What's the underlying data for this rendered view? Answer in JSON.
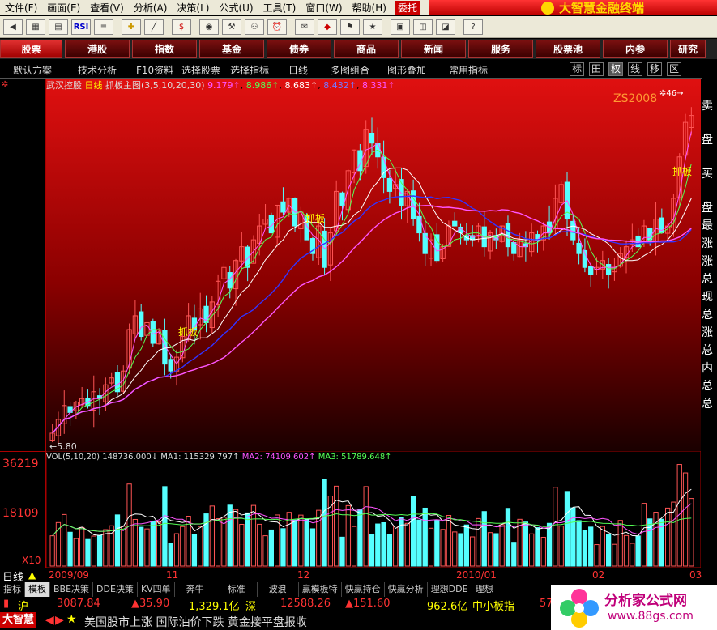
{
  "menu": {
    "items": [
      "文件(F)",
      "画面(E)",
      "查看(V)",
      "分析(A)",
      "决策(L)",
      "公式(U)",
      "工具(T)",
      "窗口(W)",
      "帮助(H)"
    ],
    "window_tag": "委托",
    "app_title": "大智慧金融终端"
  },
  "toolbar": {
    "rsi_label": "RSI"
  },
  "categories": [
    "股票",
    "港股",
    "指数",
    "基金",
    "债券",
    "商品",
    "新闻",
    "服务",
    "股票池",
    "内参",
    "研究"
  ],
  "funcbar": {
    "items": [
      "默认方案",
      "技术分析",
      "F10资料",
      "选择股票",
      "选择指标",
      "日线",
      "多图组合",
      "图形叠加",
      "常用指标"
    ],
    "buttons": [
      "标",
      "田",
      "权",
      "线",
      "移",
      "区"
    ]
  },
  "chart_header": {
    "stock": "武汉控股",
    "period": "日线",
    "indicator": "抓板主图(3,5,10,20,30)",
    "values": [
      "9.179↑",
      "8.986↑",
      "8.683↑",
      "8.432↑",
      "8.331↑"
    ],
    "colors": [
      "#ff55ff",
      "#55ff55",
      "#ffffff",
      "#5555ff",
      "#ff55ff"
    ],
    "watermark": "ZS2008",
    "high_label": "46",
    "low_label": "5.80",
    "signal": "抓板"
  },
  "vol_header": {
    "label": "VOL(5,10,20)",
    "vol": "148736.000↓",
    "ma1": "MA1: 115329.797↑",
    "ma2": "MA2: 74109.602↑",
    "ma3": "MA3: 51789.648↑"
  },
  "axis": {
    "vol_top": "36219",
    "vol_mid": "18109",
    "vol_unit": "X10",
    "dates": [
      "2009/09",
      "11",
      "12",
      "2010/01",
      "02",
      "03"
    ]
  },
  "right_panel": [
    "卖",
    "盘",
    "买",
    "盘",
    "最",
    "涨",
    "涨",
    "总",
    "现",
    "总",
    "涨",
    "总",
    "内",
    "总",
    "总"
  ],
  "day_label": "日线",
  "bottom_tabs": [
    "指标",
    "模板",
    "BBE决策",
    "DDE决策",
    "KV四单",
    "奔牛",
    "标准",
    "波浪",
    "赢模板特",
    "快赢持仓",
    "快赢分析",
    "理想DDE",
    "理想"
  ],
  "quotes": {
    "sh_label": "沪",
    "sh_price": "3087.84",
    "sh_change": "▲35.90",
    "sh_amount": "1,329.1亿",
    "sz_label": "深",
    "sz_price": "12588.26",
    "sz_change": "▲151.60",
    "sz_amount": "962.6亿",
    "sme_label": "中小板指",
    "sme_price": "57"
  },
  "news": {
    "logo": "大智慧",
    "text": "美国股市上涨 国际油价下跌 黄金接平盘报收"
  },
  "watermark_site": {
    "title": "分析家公式网",
    "url": "www.88gs.com"
  },
  "chart_data": {
    "type": "candlestick",
    "title": "武汉控股 日线",
    "low_label_value": 5.8,
    "closes": [
      5.9,
      6.1,
      6.3,
      6.2,
      6.35,
      6.4,
      6.3,
      6.5,
      6.4,
      6.6,
      6.7,
      6.5,
      6.8,
      7.4,
      7.6,
      7.3,
      7.5,
      7.2,
      7.4,
      6.9,
      6.8,
      7.0,
      7.3,
      7.6,
      7.4,
      7.7,
      7.5,
      7.8,
      8.1,
      8.3,
      8.0,
      8.4,
      8.6,
      8.3,
      8.7,
      8.9,
      9.0,
      8.8,
      9.2,
      9.1,
      9.3,
      8.9,
      9.1,
      8.7,
      8.5,
      8.9,
      8.3,
      8.8,
      9.4,
      9.2,
      9.7,
      10.0,
      9.7,
      10.3,
      10.1,
      9.9,
      9.6,
      9.4,
      9.5,
      9.2,
      9.4,
      9.0,
      8.8,
      8.5,
      8.7,
      8.4,
      8.6,
      8.9,
      8.9,
      8.8,
      8.7,
      8.7,
      8.9,
      8.6,
      8.8,
      8.7,
      8.9,
      8.6,
      8.5,
      8.7,
      8.6,
      8.8,
      8.7,
      8.9,
      8.8,
      9.3,
      9.5,
      9.0,
      8.7,
      8.5,
      8.3,
      8.2,
      8.3,
      8.4,
      8.2,
      8.3,
      8.5,
      8.6,
      8.7,
      8.6,
      8.9,
      8.7,
      9.0,
      8.8,
      8.9,
      9.3,
      9.9,
      10.4,
      10.5
    ],
    "volume_ma": [
      "MA1",
      "MA2",
      "MA3"
    ]
  }
}
